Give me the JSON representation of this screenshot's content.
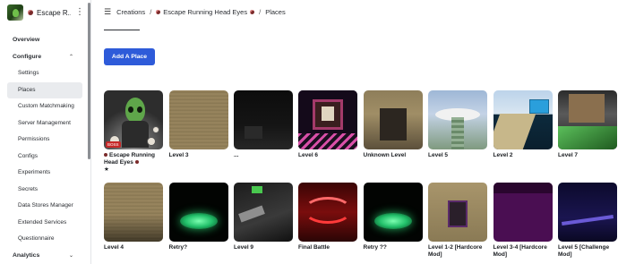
{
  "experience": {
    "name": "Escape R...",
    "menu_icon": "more-vertical-icon"
  },
  "sidebar": {
    "items": [
      {
        "label": "Overview"
      },
      {
        "label": "Configure"
      },
      {
        "label": "Settings"
      },
      {
        "label": "Places"
      },
      {
        "label": "Custom Matchmaking"
      },
      {
        "label": "Server Management"
      },
      {
        "label": "Permissions"
      },
      {
        "label": "Configs"
      },
      {
        "label": "Experiments"
      },
      {
        "label": "Secrets"
      },
      {
        "label": "Data Stores Manager"
      },
      {
        "label": "Extended Services"
      },
      {
        "label": "Questionnaire"
      },
      {
        "label": "Analytics"
      }
    ],
    "active": "Places"
  },
  "breadcrumb": {
    "items": [
      "Creations",
      "Escape Running Head Eyes",
      "Places"
    ],
    "separator": "/"
  },
  "actions": {
    "add_place_label": "Add A Place"
  },
  "places": [
    {
      "label": "Escape Running Head Eyes",
      "star": "★",
      "badge": "BOSS"
    },
    {
      "label": "Level 3"
    },
    {
      "label": "..."
    },
    {
      "label": "Level 6"
    },
    {
      "label": "Unknown Level"
    },
    {
      "label": "Level 5"
    },
    {
      "label": "Level 2"
    },
    {
      "label": "Level 7"
    },
    {
      "label": "Level 4"
    },
    {
      "label": "Retry?"
    },
    {
      "label": "Level 9"
    },
    {
      "label": "Final Battle"
    },
    {
      "label": "Retry ??"
    },
    {
      "label": "Level 1-2 [Hardcore Mod]"
    },
    {
      "label": "Level 3-4 [Hardcore Mod]"
    },
    {
      "label": "Level 5 [Challenge Mod]"
    }
  ],
  "colors": {
    "accent": "#2e5bd9",
    "active_bg": "#e9ebee"
  }
}
